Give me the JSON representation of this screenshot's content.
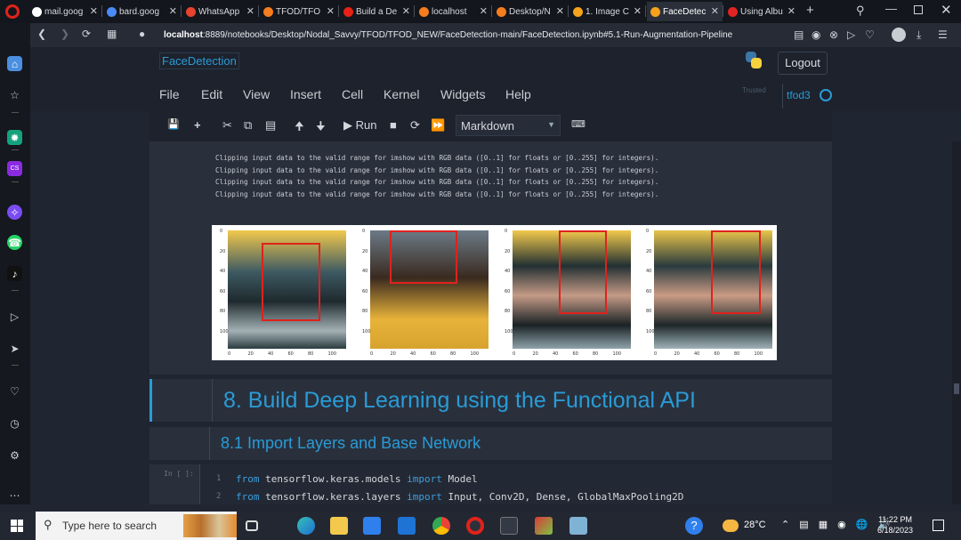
{
  "browser": {
    "tabs": [
      {
        "label": "mail.goog",
        "color": "#ffffff"
      },
      {
        "label": "bard.goog",
        "color": "#4a8af4"
      },
      {
        "label": "WhatsApp",
        "color": "#e8432d"
      },
      {
        "label": "TFOD/TFO",
        "color": "#f57c1f"
      },
      {
        "label": "Build a De",
        "color": "#e62117"
      },
      {
        "label": "localhost",
        "color": "#f57c1f"
      },
      {
        "label": "Desktop/N",
        "color": "#f57c1f"
      },
      {
        "label": "1. Image C",
        "color": "#f6a21b"
      },
      {
        "label": "FaceDetec",
        "color": "#f6a21b"
      },
      {
        "label": "Using Albu",
        "color": "#e02424"
      }
    ],
    "url_host": "localhost",
    "url_rest": ":8889/notebooks/Desktop/Nodal_Savvy/TFOD/TFOD_NEW/FaceDetection-main/FaceDetection.ipynb#5.1-Run-Augmentation-Pipeline"
  },
  "jupyter": {
    "notebook_title": "FaceDetection",
    "logout_label": "Logout",
    "menu": [
      "File",
      "Edit",
      "View",
      "Insert",
      "Cell",
      "Kernel",
      "Widgets",
      "Help"
    ],
    "trusted_label": "Trusted",
    "kernel_name": "tfod3",
    "run_label": "Run",
    "cell_type": "Markdown"
  },
  "output": {
    "warnings": [
      "Clipping input data to the valid range for imshow with RGB data ([0..1] for floats or [0..255] for integers).",
      "Clipping input data to the valid range for imshow with RGB data ([0..1] for floats or [0..255] for integers).",
      "Clipping input data to the valid range for imshow with RGB data ([0..1] for floats or [0..255] for integers).",
      "Clipping input data to the valid range for imshow with RGB data ([0..1] for floats or [0..255] for integers)."
    ],
    "figure": {
      "x_ticks": [
        "0",
        "20",
        "40",
        "60",
        "80",
        "100"
      ],
      "y_ticks": [
        "0",
        "20",
        "40",
        "60",
        "80",
        "100"
      ]
    }
  },
  "cells": {
    "heading1": "8. Build Deep Learning using the Functional API",
    "heading2": "8.1 Import Layers and Base Network",
    "code_prompt": "In [ ]:",
    "code_lines": [
      {
        "num": "1",
        "kw1": "from",
        "mod": " tensorflow.keras.models ",
        "kw2": "import",
        "names": " Model"
      },
      {
        "num": "2",
        "kw1": "from",
        "mod": " tensorflow.keras.layers ",
        "kw2": "import",
        "names": " Input, Conv2D, Dense, GlobalMaxPooling2D"
      }
    ]
  },
  "taskbar": {
    "search_placeholder": "Type here to search",
    "weather": "28°C",
    "time": "11:22 PM",
    "date": "6/18/2023"
  }
}
